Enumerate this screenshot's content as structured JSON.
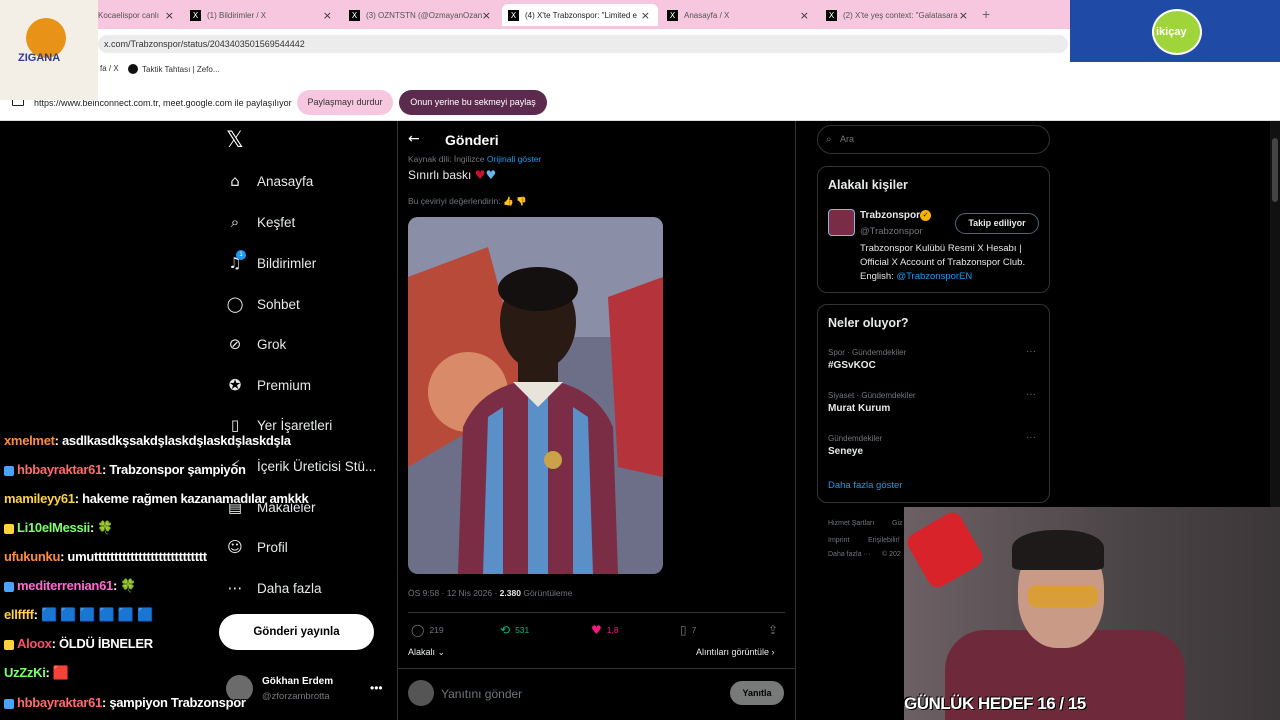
{
  "browser": {
    "tabs": [
      {
        "label": "Kocaelispor canlı",
        "active": false
      },
      {
        "label": "(1) Bildirimler / X",
        "active": false
      },
      {
        "label": "(3) OZNTSTN (@OzmayanOzan",
        "active": false
      },
      {
        "label": "(4) X'te Trabzonspor: \"Limited e",
        "active": true
      },
      {
        "label": "Anasayfa / X",
        "active": false
      },
      {
        "label": "(2) X'te yeş context: \"Galatasara",
        "active": false
      }
    ],
    "url": "x.com/Trabzonspor/status/2043403501569544442",
    "bookmarks": [
      "fa / X",
      "Taktik Tahtası | Zefo..."
    ],
    "share_text": "https://www.beinconnect.com.tr, meet.google.com ile paylaşılıyor",
    "stop_share": "Paylaşmayı durdur",
    "switch_share": "Onun yerine bu sekmeyi paylaş"
  },
  "logos": {
    "left": "ZIGANA",
    "right": "ikiçay"
  },
  "nav": {
    "items": [
      {
        "label": "Anasayfa",
        "icon": "home-icon",
        "glyph": "⌂"
      },
      {
        "label": "Keşfet",
        "icon": "search-icon",
        "glyph": "⌕"
      },
      {
        "label": "Bildirimler",
        "icon": "bell-icon",
        "glyph": "♫"
      },
      {
        "label": "Sohbet",
        "icon": "chat-icon",
        "glyph": "◯"
      },
      {
        "label": "Grok",
        "icon": "grok-icon",
        "glyph": "⊘"
      },
      {
        "label": "Premium",
        "icon": "premium-icon",
        "glyph": "✪"
      },
      {
        "label": "Yer İşaretleri",
        "icon": "bookmark-icon",
        "glyph": "▯"
      },
      {
        "label": "İçerik Üreticisi Stü...",
        "icon": "creator-icon",
        "glyph": "⚡"
      },
      {
        "label": "Makaleler",
        "icon": "article-icon",
        "glyph": "▤"
      },
      {
        "label": "Profil",
        "icon": "profile-icon",
        "glyph": "☺"
      },
      {
        "label": "Daha fazla",
        "icon": "more-icon",
        "glyph": "⋯"
      }
    ],
    "post_button": "Gönderi yayınla",
    "notification_badge": "1"
  },
  "account": {
    "name": "Gökhan Erdem",
    "handle": "@zforzambrotta"
  },
  "post": {
    "header": "Gönderi",
    "source_lang": "Kaynak dili: İngilizce",
    "show_original": "Orijinali göster",
    "text": "Sınırlı baskı",
    "rate": "Bu çeviriyi değerlendirin:",
    "time": "ÖS 9:58 · 12 Nis 2026 · ",
    "views": "2.380",
    "views_label": "Görüntüleme",
    "replies": "219",
    "reposts": "531",
    "likes": "1,8",
    "bookmarks": "7",
    "sort": "Alakalı",
    "quotes": "Alıntıları görüntüle",
    "reply_placeholder": "Yanıtını gönder",
    "reply_button": "Yanıtla"
  },
  "search": {
    "placeholder": "Ara"
  },
  "relevant": {
    "title": "Alakalı kişiler",
    "name": "Trabzonspor",
    "handle": "@Trabzonspor",
    "follow": "Takip ediliyor",
    "bio": "Trabzonspor Kulübü Resmi X Hesabı | Official X Account of Trabzonspor Club. English: ",
    "bio_link": "@TrabzonsporEN"
  },
  "trends": {
    "title": "Neler oluyor?",
    "items": [
      {
        "category": "Spor · Gündemdekiler",
        "name": "#GSvKOC"
      },
      {
        "category": "Siyaset · Gündemdekiler",
        "name": "Murat Kurum"
      },
      {
        "category": "Gündemdekiler",
        "name": "Seneye"
      }
    ],
    "show_more": "Daha fazla göster"
  },
  "footer": [
    "Hizmet Şartları",
    "Giz",
    "Imprint",
    "Erişilebilirl",
    "Daha fazla ···",
    "© 202"
  ],
  "chat": [
    {
      "user": "xmelmet",
      "msg": ": asdlkasdkşsakdşlaskdşlaskdşlaskdşla",
      "color": "#ff8c3a"
    },
    {
      "user": "hbbayraktar61",
      "msg": ": Trabzonspor şampiyon",
      "color": "#ff6b6b"
    },
    {
      "user": "mamileyy61",
      "msg": ": hakeme rağmen kazanamadılar amkkk",
      "color": "#ffd23f"
    },
    {
      "user": "Li10elMessii",
      "msg": ": 🍀",
      "color": "#7cff6b"
    },
    {
      "user": "ufukunku",
      "msg": ": umutttttttttttttttttttttttttttt",
      "color": "#ff8c3a"
    },
    {
      "user": "mediterrenian61",
      "msg": ": 🍀",
      "color": "#ff6bd0"
    },
    {
      "user": "ellffff",
      "msg": ": 🟦 🟦 🟦 🟦 🟦 🟦",
      "color": "#ffd23f"
    },
    {
      "user": "Aloox",
      "msg": ": ÖLDÜ İBNELER",
      "color": "#ff4d6d"
    },
    {
      "user": "UzZzKi",
      "msg": ": 🟥",
      "color": "#7cff6b"
    },
    {
      "user": "hbbayraktar61",
      "msg": ": şampiyon Trabzonspor",
      "color": "#ff6b6b"
    }
  ],
  "webcam_overlay": "GÜNLÜK HEDEF 16 / 15"
}
